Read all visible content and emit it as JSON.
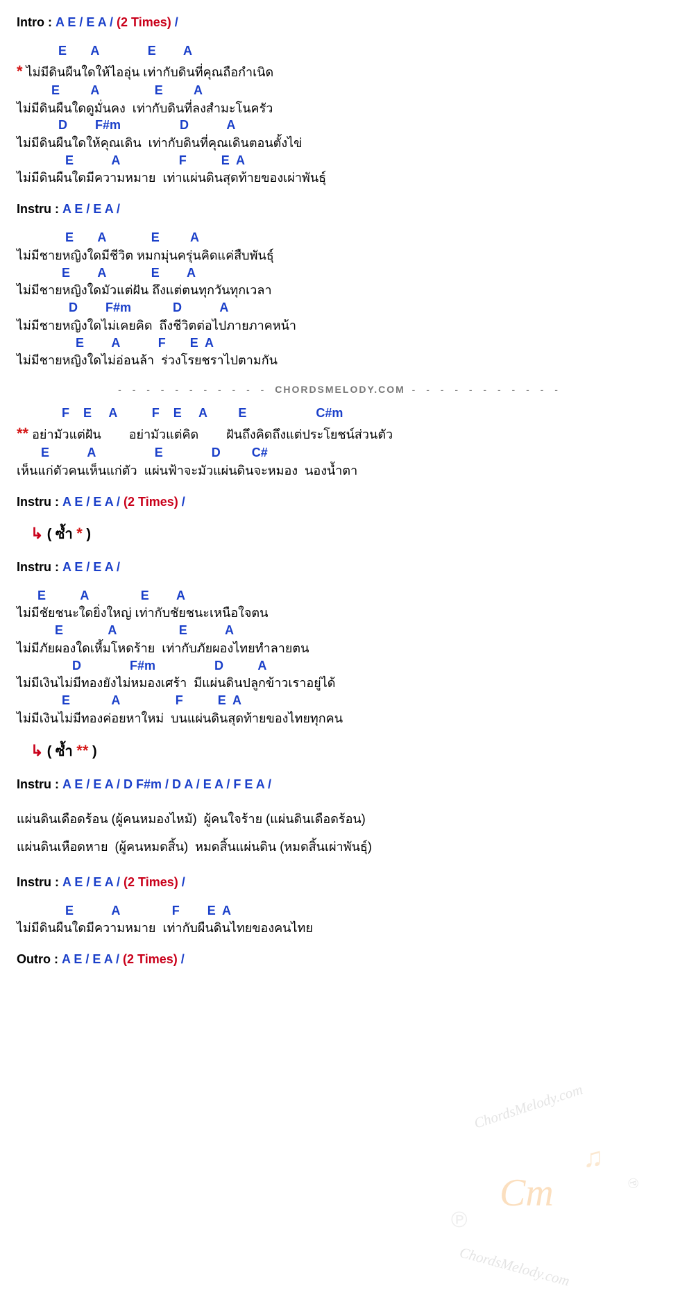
{
  "intro": {
    "label": "Intro :",
    "chords": "A  E  /  E  A  /",
    "times": "(2 Times)",
    "tail": "/"
  },
  "verse1": {
    "l1c": "            E       A              E        A",
    "l1t": "* ไม่มีดินผืนใดให้ไออุ่น เท่ากับดินที่คุณถือกำเนิด",
    "l2c": "          E         A                E         A",
    "l2t": "ไม่มีดินผืนใดดูมั่นคง  เท่ากับดินที่ลงสำมะโนครัว",
    "l3c": "            D        F#m                 D           A",
    "l3t": "ไม่มีดินผืนใดให้คุณเดิน  เท่ากับดินที่คุณเดินตอนตั้งไข่",
    "l4c": "              E           A                 F          E  A",
    "l4t": "ไม่มีดินผืนใดมีความหมาย  เท่าแผ่นดินสุดท้ายของเผ่าพันธุ์"
  },
  "instru1": {
    "label": "Instru :",
    "chords": "A  E  /  E  A  /"
  },
  "verse2": {
    "l1c": "              E       A             E         A",
    "l1t": "ไม่มีชายหญิงใดมีชีวิต หมกมุ่นครุ่นคิดแค่สืบพันธุ์",
    "l2c": "             E        A             E        A",
    "l2t": "ไม่มีชายหญิงใดมัวแต่ฝัน ถึงแต่ตนทุกวันทุกเวลา",
    "l3c": "               D        F#m            D           A",
    "l3t": "ไม่มีชายหญิงใดไม่เคยคิด  ถึงชีวิตต่อไปภายภาคหน้า",
    "l4c": "                 E        A           F       E  A",
    "l4t": "ไม่มีชายหญิงใดไม่อ่อนล้า  ร่วงโรยชราไปตามกัน"
  },
  "divider": {
    "dash": "- - - - - - - - - - -",
    "site": "CHORDSMELODY.COM"
  },
  "chorus": {
    "l1c": "             F    E     A          F    E     A         E                    C#m",
    "l1t": "** อย่ามัวแต่ฝัน        อย่ามัวแต่คิด        ฝันถึงคิดถึงแต่ประโยชน์ส่วนตัว",
    "l2c": "       E           A                 E              D         C#",
    "l2t": "เห็นแก่ตัวคนเห็นแก่ตัว  แผ่นฟ้าจะมัวแผ่นดินจะหมอง  นองน้ำตา"
  },
  "instru2": {
    "label": "Instru :",
    "chords": "A  E  /  E  A  /",
    "times": "(2 Times)",
    "tail": "/"
  },
  "repeat1": {
    "arrow": "↳",
    "text": "( ซ้ำ  *  )"
  },
  "instru3": {
    "label": "Instru :",
    "chords": "A  E  /  E  A  /"
  },
  "verse3": {
    "l1c": "      E          A               E        A",
    "l1t": "ไม่มีชัยชนะใดยิ่งใหญ่ เท่ากับชัยชนะเหนือใจตน",
    "l2c": "           E             A                  E           A",
    "l2t": "ไม่มีภัยผองใดเหี้มโหดร้าย  เท่ากับภัยผองไทยทำลายตน",
    "l3c": "                D              F#m                 D          A",
    "l3t": "ไม่มีเงินไม่มีทองยังไม่หมองเศร้า  มีแผ่นดินปลูกข้าวเราอยู่ได้",
    "l4c": "             E            A                F          E  A",
    "l4t": "ไม่มีเงินไม่มีทองค่อยหาใหม่  บนแผ่นดินสุดท้ายของไทยทุกคน"
  },
  "repeat2": {
    "arrow": "↳",
    "text": "( ซ้ำ  **  )"
  },
  "instru4": {
    "label": "Instru :",
    "chords": "A  E  /  E  A  /  D  F#m  /  D  A  /  E  A  /  F  E  A  /"
  },
  "bridge": {
    "l1": "แผ่นดินเดือดร้อน (ผู้คนหมองไหม้)  ผู้คนใจร้าย (แผ่นดินเดือดร้อน)",
    "l2": "แผ่นดินเหือดหาย  (ผู้คนหมดสิ้น)  หมดสิ้นแผ่นดิน (หมดสิ้นเผ่าพันธุ์)"
  },
  "instru5": {
    "label": "Instru :",
    "chords": "A  E  /  E  A  /",
    "times": "(2 Times)",
    "tail": "/"
  },
  "ending": {
    "l1c": "              E           A               F        E  A",
    "l1t": "ไม่มีดินผืนใดมีความหมาย  เท่ากับผืนดินไทยของคนไทย"
  },
  "outro": {
    "label": "Outro :",
    "chords": "A  E  /  E  A  /",
    "times": "(2 Times)",
    "tail": "/"
  },
  "watermark": {
    "cm": "Cm",
    "note": "♫",
    "txt1": "ChordsMelody.com",
    "txt2": "ChordsMelody.com"
  }
}
